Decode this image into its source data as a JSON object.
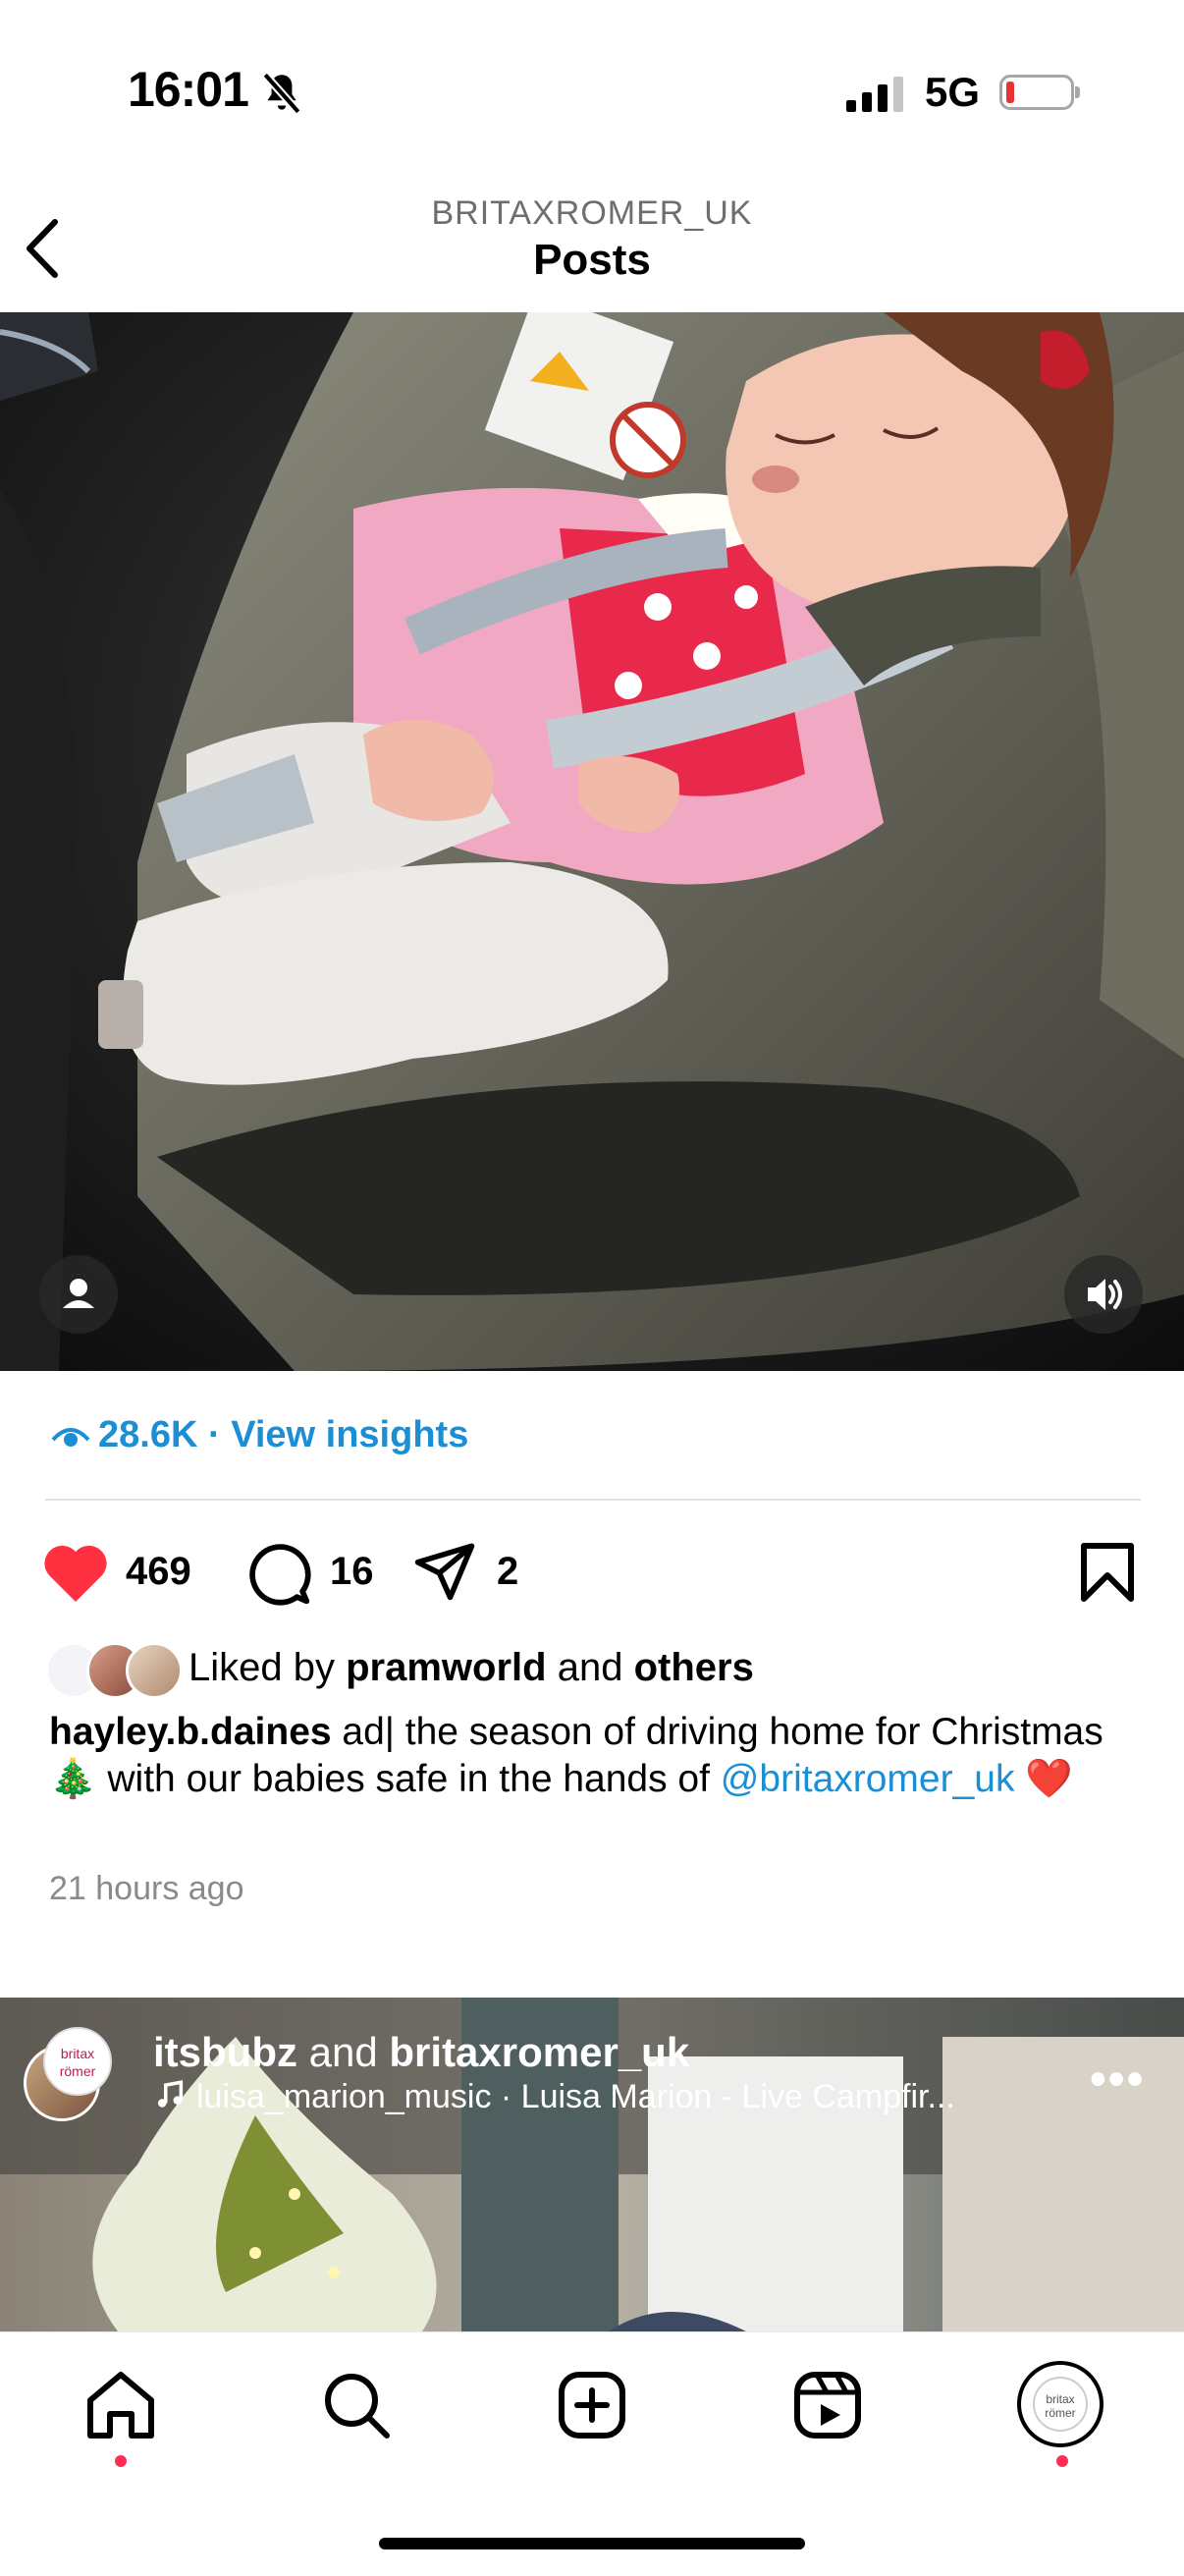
{
  "status_bar": {
    "time": "16:01",
    "network": "5G"
  },
  "header": {
    "account": "BRITAXROMER_UK",
    "title": "Posts"
  },
  "insights": {
    "views": "28.6K",
    "separator": "·",
    "link": "View insights"
  },
  "actions": {
    "likes": "469",
    "comments": "16",
    "shares": "2"
  },
  "liked_by": {
    "prefix": "Liked by",
    "user": "pramworld",
    "conj": "and",
    "others": "others"
  },
  "caption": {
    "user": "hayley.b.daines",
    "text": " ad| the season of driving home for Christmas 🎄 with our babies safe in the hands of ",
    "mention": "@britaxromer_uk",
    "emoji": "❤️"
  },
  "time_ago": "21 hours ago",
  "next_post": {
    "user1": "itsbubz",
    "conj": "and",
    "user2": "britaxromer_uk",
    "audio": "luisa_marion_music · Luisa Marion - Live Campfir...",
    "brand_avatar_text": "britax römer",
    "more": "•••"
  },
  "colors": {
    "accent": "#1a8fd6",
    "like": "#ff3040",
    "notification": "#ff2d55"
  }
}
